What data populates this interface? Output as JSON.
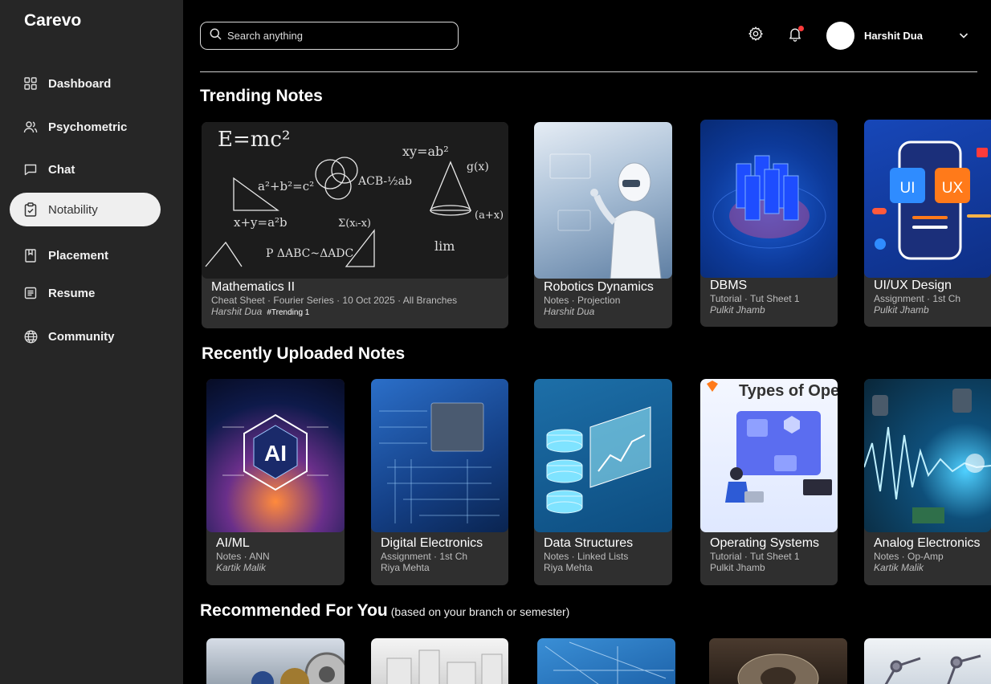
{
  "app": {
    "brand": "Carevo"
  },
  "sidebar": {
    "items": [
      {
        "label": "Dashboard",
        "icon": "grid-icon"
      },
      {
        "label": "Psychometric",
        "icon": "users-icon"
      },
      {
        "label": "Chat",
        "icon": "chat-icon"
      },
      {
        "label": "Notability",
        "icon": "clipboard-check-icon",
        "active": true
      },
      {
        "label": "Placement",
        "icon": "bookmark-book-icon"
      },
      {
        "label": "Resume",
        "icon": "document-icon"
      },
      {
        "label": "Community",
        "icon": "globe-icon"
      }
    ]
  },
  "header": {
    "search_placeholder": "Search anything",
    "user_name": "Harshit Dua"
  },
  "sections": {
    "trending": {
      "title": "Trending Notes",
      "cards": [
        {
          "title": "Mathematics II",
          "subtitle": "Cheat Sheet · Fourier Series · 10 Oct 2025 · All Branches",
          "author": "Harshit Dua",
          "tag": "#Trending 1"
        },
        {
          "title": "Robotics Dynamics",
          "subtitle": "Notes · Projection",
          "author": "Harshit Dua"
        },
        {
          "title": "DBMS",
          "subtitle": "Tutorial ·  Tut Sheet 1",
          "author": "Pulkit Jhamb"
        },
        {
          "title": "UI/UX Design",
          "subtitle": "Assignment · 1st Ch",
          "author": "Pulkit Jhamb",
          "img_text_1": "UI",
          "img_text_2": "UX"
        }
      ]
    },
    "recent": {
      "title": "Recently Uploaded Notes",
      "cards": [
        {
          "title": "AI/ML",
          "subtitle": "Notes · ANN",
          "author": "Kartik Malik",
          "img_text": "AI"
        },
        {
          "title": "Digital Electronics",
          "subtitle": "Assignment · 1st Ch",
          "author": "Riya Mehta"
        },
        {
          "title": "Data Structures",
          "subtitle": "Notes · Linked Lists",
          "author": "Riya Mehta"
        },
        {
          "title": "Operating Systems",
          "subtitle": "Tutorial ·  Tut Sheet 1",
          "author": "Pulkit Jhamb",
          "img_text": "Types of Ope"
        },
        {
          "title": "Analog Electronics",
          "subtitle": "Notes · Op-Amp",
          "author": "Kartik Malik"
        }
      ]
    },
    "recommended": {
      "title": "Recommended For You",
      "subtitle": "(based on your branch or semester)"
    }
  },
  "colors": {
    "sidebar_bg": "#262626",
    "card_bg": "#2f2f2f",
    "active_nav_bg": "#efefef",
    "notification_dot": "#ff3b3b"
  }
}
